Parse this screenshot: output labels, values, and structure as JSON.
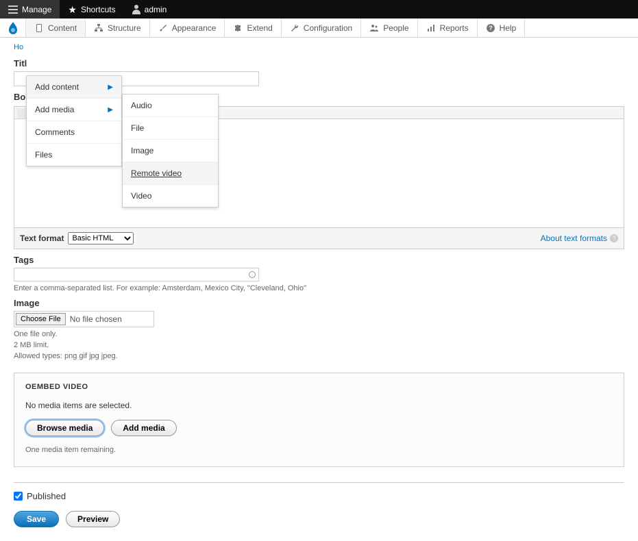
{
  "toolbar": {
    "manage": "Manage",
    "shortcuts": "Shortcuts",
    "admin": "admin"
  },
  "admin_menu": {
    "items": [
      {
        "label": "Content",
        "icon": "file-icon"
      },
      {
        "label": "Structure",
        "icon": "structure-icon"
      },
      {
        "label": "Appearance",
        "icon": "brush-icon"
      },
      {
        "label": "Extend",
        "icon": "puzzle-icon"
      },
      {
        "label": "Configuration",
        "icon": "wrench-icon"
      },
      {
        "label": "People",
        "icon": "people-icon"
      },
      {
        "label": "Reports",
        "icon": "reports-icon"
      },
      {
        "label": "Help",
        "icon": "help-icon"
      }
    ]
  },
  "dropdown1": {
    "items": [
      "Add content",
      "Add media",
      "Comments",
      "Files"
    ]
  },
  "dropdown2": {
    "items": [
      "Audio",
      "File",
      "Image",
      "Remote video",
      "Video"
    ]
  },
  "breadcrumb": "Ho",
  "form": {
    "title_label": "Titl",
    "body_label": "Bo",
    "text_format_label": "Text format",
    "text_format_value": "Basic HTML",
    "about_formats": "About text formats",
    "tags_label": "Tags",
    "tags_hint": "Enter a comma-separated list. For example: Amsterdam, Mexico City, \"Cleveland, Ohio\"",
    "image_label": "Image",
    "choose_file": "Choose File",
    "no_file": "No file chosen",
    "file_hint1": "One file only.",
    "file_hint2": "2 MB limit.",
    "file_hint3": "Allowed types: png gif jpg jpeg."
  },
  "oembed": {
    "title": "OEMBED VIDEO",
    "no_items": "No media items are selected.",
    "browse": "Browse media",
    "add": "Add media",
    "remaining": "One media item remaining."
  },
  "published_label": "Published",
  "save_label": "Save",
  "preview_label": "Preview"
}
